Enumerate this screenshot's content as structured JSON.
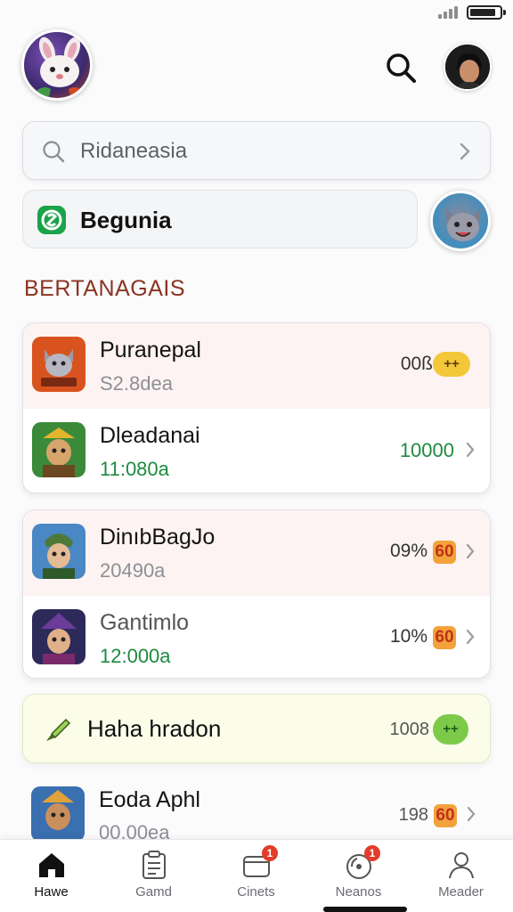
{
  "header": {
    "logo_icon": "bunny-mascot-icon",
    "search_icon": "search-icon",
    "user_avatar": "user-avatar"
  },
  "search": {
    "text": "Ridaneasia"
  },
  "pill": {
    "label": "Begunia",
    "icon": "app-badge-icon"
  },
  "section_title": "BERTANAGAIS",
  "card1": {
    "rows": [
      {
        "title": "Puranepal",
        "subtitle": "S2.8dea",
        "value": "00ß",
        "badge": "++"
      },
      {
        "title": "Dleadanai",
        "subtitle": "11:080a",
        "value": "10000"
      }
    ]
  },
  "card2": {
    "rows": [
      {
        "title": "DinıbBagJo",
        "subtitle": "20490a",
        "value": "09%",
        "badge": "60"
      },
      {
        "title": "Gantimlo",
        "subtitle": "12:000a",
        "value": "10%",
        "badge": "60"
      }
    ]
  },
  "hint": {
    "label": "Haha hradon",
    "value": "1008",
    "badge": "++"
  },
  "peek": {
    "title": "Eoda Aphl",
    "subtitle": "00.00ea",
    "value": "198",
    "badge": "60"
  },
  "tabs": [
    {
      "label": "Hawe",
      "icon": "home-icon",
      "active": true
    },
    {
      "label": "Gamd",
      "icon": "clipboard-icon"
    },
    {
      "label": "Cinets",
      "icon": "folder-icon",
      "badge": "1"
    },
    {
      "label": "Neanos",
      "icon": "music-disc-icon",
      "badge": "1"
    },
    {
      "label": "Meader",
      "icon": "person-icon"
    }
  ],
  "colors": {
    "accent_green": "#1e8a3f",
    "section_red": "#8b3322",
    "badge_yellow": "#f4c73a",
    "badge_orange": "#f3a23b",
    "badge_green": "#7dca4a"
  }
}
